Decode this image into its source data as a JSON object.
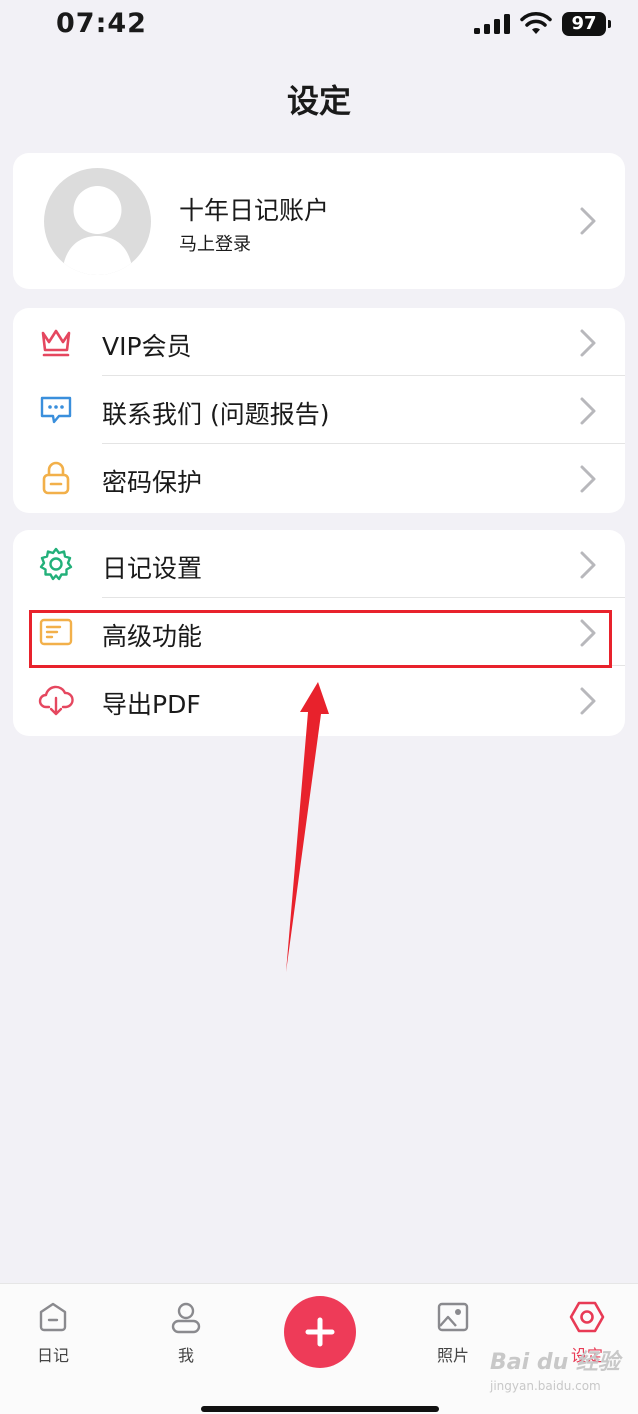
{
  "status": {
    "time": "07:42",
    "battery": "97"
  },
  "header": {
    "title": "设定"
  },
  "profile": {
    "name": "十年日记账户",
    "subtitle": "马上登录"
  },
  "group1": [
    {
      "label": "VIP会员",
      "icon": "crown-icon",
      "color": "#e5475f"
    },
    {
      "label": "联系我们 (问题报告)",
      "icon": "chat-bubble-icon",
      "color": "#3a8fdc"
    },
    {
      "label": "密码保护",
      "icon": "lock-icon",
      "color": "#f2b04a"
    }
  ],
  "group2": [
    {
      "label": "日记设置",
      "icon": "gear-icon",
      "color": "#23b07a"
    },
    {
      "label": "高级功能",
      "icon": "document-card-icon",
      "color": "#f2b04a"
    },
    {
      "label": "导出PDF",
      "icon": "cloud-download-icon",
      "color": "#e5475f"
    }
  ],
  "tabbar": {
    "tabs": [
      {
        "label": "日记",
        "icon": "diary-icon"
      },
      {
        "label": "我",
        "icon": "person-icon"
      },
      {
        "label": "照片",
        "icon": "photo-icon"
      },
      {
        "label": "设定",
        "icon": "settings-hex-icon",
        "active": true
      }
    ],
    "add_icon": "plus-icon"
  },
  "watermark": {
    "text": "Bai du 经验",
    "sub": "jingyan.baidu.com"
  },
  "colors": {
    "accent": "#ee3b58",
    "highlight": "#e8222c",
    "background": "#f2f1f6"
  }
}
